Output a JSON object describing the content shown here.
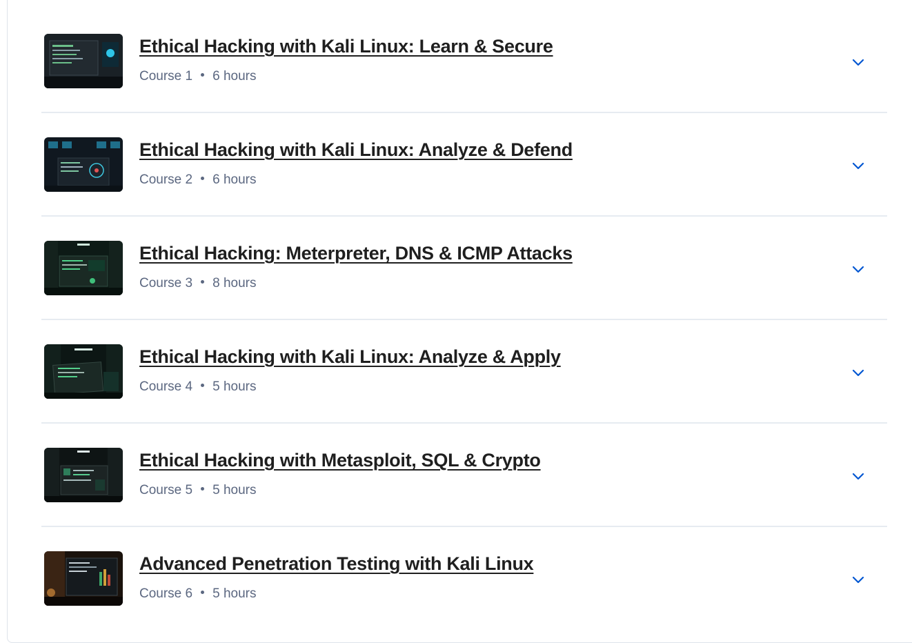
{
  "courses": [
    {
      "title": "Ethical Hacking with Kali Linux: Learn & Secure",
      "course_label": "Course 1",
      "duration": "6 hours"
    },
    {
      "title": "Ethical Hacking with Kali Linux: Analyze & Defend",
      "course_label": "Course 2",
      "duration": "6 hours"
    },
    {
      "title": "Ethical Hacking: Meterpreter, DNS & ICMP Attacks",
      "course_label": "Course 3",
      "duration": "8 hours"
    },
    {
      "title": "Ethical Hacking with Kali Linux: Analyze & Apply",
      "course_label": "Course 4",
      "duration": "5 hours"
    },
    {
      "title": "Ethical Hacking with Metasploit, SQL & Crypto",
      "course_label": "Course 5",
      "duration": "5 hours"
    },
    {
      "title": "Advanced Penetration Testing with Kali Linux",
      "course_label": "Course 6",
      "duration": "5 hours"
    }
  ],
  "icons": {
    "expand": "chevron-down-icon",
    "thumbnail": "course-thumbnail"
  },
  "colors": {
    "title": "#1f1f1f",
    "meta": "#5b6780",
    "chevron": "#0056d2",
    "divider": "#e6ebf1"
  }
}
